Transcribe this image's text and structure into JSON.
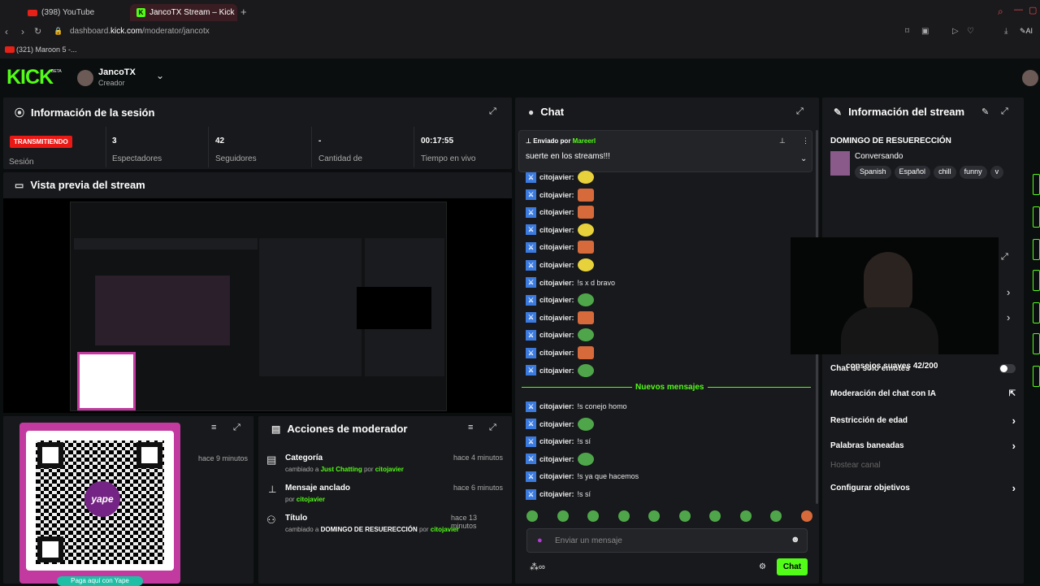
{
  "browser": {
    "tabs": [
      {
        "label": "(398) YouTube"
      },
      {
        "label": "JancoTX Stream – Kick"
      }
    ],
    "url_prefix": "dashboard.",
    "url_domain": "kick.com",
    "url_path": "/moderator/jancotx",
    "bookmark": "(321) Maroon 5 -..."
  },
  "brand": {
    "logo": "KICK",
    "beta": "BETA"
  },
  "user": {
    "name": "JancoTX",
    "role": "Creador"
  },
  "session": {
    "title": "Información de la sesión",
    "status": "TRANSMITIENDO",
    "status_sub": "Sesión",
    "stats": [
      {
        "value": "3",
        "label": "Espectadores"
      },
      {
        "value": "42",
        "label": "Seguidores"
      },
      {
        "value": "-",
        "label": "Cantidad de"
      },
      {
        "value": "00:17:55",
        "label": "Tiempo en vivo"
      }
    ]
  },
  "preview": {
    "title": "Vista previa del stream"
  },
  "qr_card": {
    "caption": "Paga aquí con Yape",
    "brand": "yape"
  },
  "left_lower": {
    "time": "hace 9 minutos"
  },
  "mod_actions": {
    "title": "Acciones de moderador",
    "items": [
      {
        "title": "Categoría",
        "prefix": "cambiado a",
        "target": "Just Chatting",
        "by": "por",
        "user": "citojavier",
        "time": "hace 4 minutos"
      },
      {
        "title": "Mensaje anclado",
        "by": "por",
        "user": "citojavier",
        "time": "hace 6 minutos"
      },
      {
        "title": "Título",
        "prefix": "cambiado a",
        "target": "DOMINGO DE RESUERECCIÓN",
        "by": "por",
        "user": "citojavier",
        "time": "hace 13 minutos"
      }
    ]
  },
  "chat": {
    "title": "Chat",
    "pinned_by_label": "Enviado por",
    "pinned_user": "Mareerl",
    "pinned_text": "suerte en los streams!!!",
    "new_messages": "Nuevos mensajes",
    "messages_before": [
      {
        "user": "citojavier:",
        "text": "",
        "emote": "yellow"
      },
      {
        "user": "citojavier:",
        "text": "",
        "emote": "orange"
      },
      {
        "user": "citojavier:",
        "text": "",
        "emote": "orange"
      },
      {
        "user": "citojavier:",
        "text": "",
        "emote": "yellow"
      },
      {
        "user": "citojavier:",
        "text": "",
        "emote": "orange"
      },
      {
        "user": "citojavier:",
        "text": "",
        "emote": "yellow"
      },
      {
        "user": "citojavier:",
        "text": "!s x d bravo",
        "emote": ""
      },
      {
        "user": "citojavier:",
        "text": "",
        "emote": "green"
      },
      {
        "user": "citojavier:",
        "text": "",
        "emote": "orange"
      },
      {
        "user": "citojavier:",
        "text": "",
        "emote": "green"
      },
      {
        "user": "citojavier:",
        "text": "",
        "emote": "orange"
      },
      {
        "user": "citojavier:",
        "text": "",
        "emote": "green"
      }
    ],
    "messages_after": [
      {
        "user": "citojavier:",
        "text": "!s conejo homo",
        "emote": ""
      },
      {
        "user": "citojavier:",
        "text": "",
        "emote": "green"
      },
      {
        "user": "citojavier:",
        "text": "!s sí",
        "emote": ""
      },
      {
        "user": "citojavier:",
        "text": "",
        "emote": "green"
      },
      {
        "user": "citojavier:",
        "text": "!s ya que hacemos",
        "emote": ""
      },
      {
        "user": "citojavier:",
        "text": "!s sí",
        "emote": ""
      }
    ],
    "input_placeholder": "Enviar un mensaje",
    "send_label": "Chat"
  },
  "stream_info": {
    "title": "Información del stream",
    "stream_title": "DOMINGO DE RESUERECCIÓN",
    "category": "Conversando",
    "tags": [
      "Spanish",
      "Español",
      "chill",
      "funny",
      "v"
    ]
  },
  "overlay": {
    "text": "consejos suaves 42/200"
  },
  "settings": {
    "emote_only": "Chat de solo emotes",
    "ai_mod": "Moderación del chat con IA",
    "age_restriction": "Restricción de edad",
    "banned_words": "Palabras baneadas",
    "host_channel": "Hostear canal",
    "goals": "Configurar objetivos"
  },
  "colors": {
    "accent": "#53fc18",
    "live": "#e91916",
    "panel": "#18191c"
  }
}
